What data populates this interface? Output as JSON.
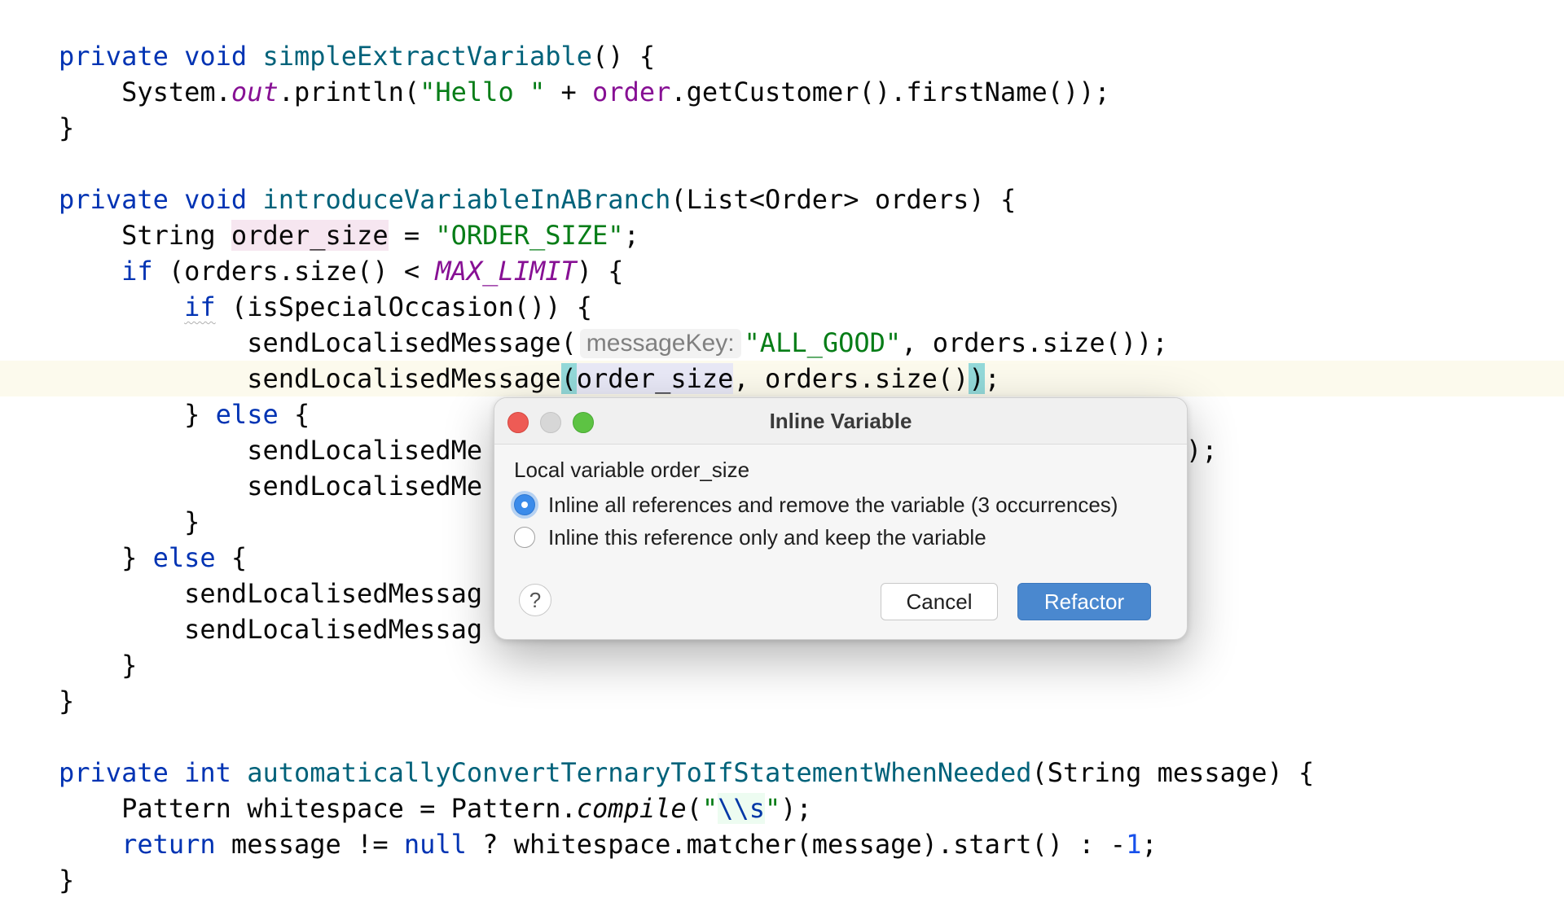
{
  "colors": {
    "keyword": "#0033b3",
    "method": "#00627a",
    "string": "#067d17",
    "field": "#871094",
    "number": "#1750eb",
    "current_line": "#fcfaed",
    "primary_button": "#4a88cf"
  },
  "editor": {
    "l1": {
      "kw": "private void ",
      "fn": "simpleExtractVariable",
      "rest": "() {"
    },
    "l2": {
      "a": "    System.",
      "out": "out",
      "b": ".println(",
      "str": "\"Hello \"",
      "c": " + ",
      "order": "order",
      "d": ".getCustomer().firstName());"
    },
    "l3": {
      "text": "}"
    },
    "l4": {
      "kw": "private void ",
      "fn": "introduceVariableInABranch",
      "rest": "(List<Order> orders) {"
    },
    "l5": {
      "a": "    String ",
      "var": "order_size",
      "b": " = ",
      "str": "\"ORDER_SIZE\"",
      "c": ";"
    },
    "l6": {
      "a": "    ",
      "kw": "if",
      "b": " (orders.size() < ",
      "const": "MAX_LIMIT",
      "c": ") {"
    },
    "l7": {
      "a": "        ",
      "kw": "if",
      "b": " (isSpecialOccasion()) {"
    },
    "l8": {
      "a": "            sendLocalisedMessage(",
      "hint": "messageKey:",
      "str": "\"ALL_GOOD\"",
      "b": ", orders.size());"
    },
    "l9": {
      "a": "            sendLocalisedMessage",
      "p1": "(",
      "var": "order_size",
      "b": ", orders.size()",
      "p2": ")",
      "c": ";"
    },
    "l10": {
      "a": "        } ",
      "kw": "else",
      "b": " {"
    },
    "l11": {
      "a": "            sendLocalisedMe",
      "tail": ");"
    },
    "l12": {
      "a": "            sendLocalisedMe"
    },
    "l13": {
      "text": "        }"
    },
    "l14": {
      "a": "    } ",
      "kw": "else",
      "b": " {"
    },
    "l15": {
      "a": "        sendLocalisedMessag"
    },
    "l16": {
      "a": "        sendLocalisedMessag"
    },
    "l17": {
      "text": "    }"
    },
    "l18": {
      "text": "}"
    },
    "l19": {
      "kw1": "private ",
      "kw2": "int ",
      "fn": "automaticallyConvertTernaryToIfStatementWhenNeeded",
      "rest": "(String message) {"
    },
    "l20": {
      "a": "    Pattern whitespace = Pattern.",
      "compile": "compile",
      "b": "(",
      "q1": "\"",
      "esc": "\\\\s",
      "q2": "\"",
      "c": ");"
    },
    "l21": {
      "a": "    ",
      "kw": "return",
      "b": " message != ",
      "null": "null",
      "c": " ? whitespace.matcher(message).start() : -",
      "num": "1",
      "d": ";"
    },
    "l22": {
      "text": "}"
    }
  },
  "dialog": {
    "title": "Inline Variable",
    "subtitle": "Local variable order_size",
    "options": [
      {
        "label": "Inline all references and remove the variable (3 occurrences)",
        "selected": true
      },
      {
        "label": "Inline this reference only and keep the variable",
        "selected": false
      }
    ],
    "help_label": "?",
    "cancel_label": "Cancel",
    "refactor_label": "Refactor"
  }
}
